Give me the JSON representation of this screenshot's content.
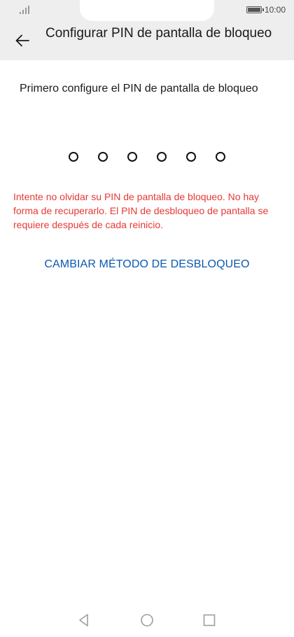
{
  "status_bar": {
    "time": "10:00",
    "battery_level": 0.9
  },
  "header": {
    "title": "Configurar PIN de pantalla de bloqueo"
  },
  "content": {
    "subtitle": "Primero configure el PIN de pantalla de bloqueo",
    "pin_length": 6,
    "warning": "Intente no olvidar su PIN de pantalla de bloqueo. No hay forma de recuperarlo. El PIN de desbloqueo de pantalla se requiere después de cada reinicio.",
    "change_method_label": "CAMBIAR MÉTODO DE DESBLOQUEO"
  },
  "colors": {
    "accent": "#0a59b0",
    "warning": "#e53935",
    "header_bg": "#eeeeee"
  },
  "icons": {
    "back": "back-arrow-icon",
    "nav_back": "triangle-back-icon",
    "nav_home": "circle-home-icon",
    "nav_recent": "square-recent-icon"
  }
}
